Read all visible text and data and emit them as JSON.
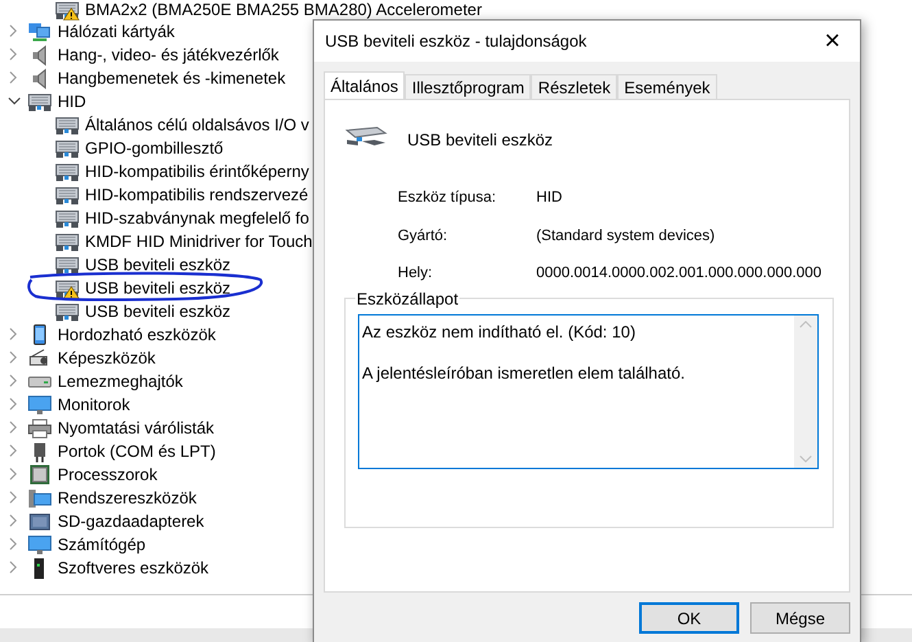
{
  "device_tree": {
    "continued_children": [
      {
        "label": "BMA2x2 (BMA250E BMA255 BMA280) Accelerometer",
        "warning": true
      }
    ],
    "categories": [
      {
        "label": "Hálózati kártyák",
        "expanded": false
      },
      {
        "label": "Hang-, video- és játékvezérlők",
        "expanded": false
      },
      {
        "label": "Hangbemenetek és -kimenetek",
        "expanded": false
      },
      {
        "label": "HID",
        "expanded": true,
        "children": [
          {
            "label": "Általános célú oldalsávos I/O v",
            "warning": false
          },
          {
            "label": "GPIO-gombillesztő",
            "warning": false
          },
          {
            "label": "HID-kompatibilis érintőképerny",
            "warning": false
          },
          {
            "label": "HID-kompatibilis rendszervezé",
            "warning": false
          },
          {
            "label": "HID-szabványnak megfelelő fo",
            "warning": false
          },
          {
            "label": "KMDF HID Minidriver for Touch",
            "warning": false
          },
          {
            "label": "USB beviteli eszköz",
            "warning": false
          },
          {
            "label": "USB beviteli eszköz",
            "warning": true
          },
          {
            "label": "USB beviteli eszköz",
            "warning": false
          }
        ]
      },
      {
        "label": "Hordozható eszközök",
        "expanded": false
      },
      {
        "label": "Képeszközök",
        "expanded": false
      },
      {
        "label": "Lemezmeghajtók",
        "expanded": false
      },
      {
        "label": "Monitorok",
        "expanded": false
      },
      {
        "label": "Nyomtatási várólisták",
        "expanded": false
      },
      {
        "label": "Portok (COM és LPT)",
        "expanded": false
      },
      {
        "label": "Processzorok",
        "expanded": false
      },
      {
        "label": "Rendszereszközök",
        "expanded": false
      },
      {
        "label": "SD-gazdaadapterek",
        "expanded": false
      },
      {
        "label": "Számítógép",
        "expanded": false
      },
      {
        "label": "Szoftveres eszközök",
        "expanded": false
      }
    ]
  },
  "dialog": {
    "title": "USB beviteli eszköz - tulajdonságok",
    "close": "×",
    "tabs": [
      {
        "label": "Általános",
        "selected": true
      },
      {
        "label": "Illesztőprogram",
        "selected": false
      },
      {
        "label": "Részletek",
        "selected": false
      },
      {
        "label": "Események",
        "selected": false
      }
    ],
    "device_name": "USB beviteli eszköz",
    "properties": [
      {
        "label": "Eszköz típusa:",
        "value": "HID"
      },
      {
        "label": "Gyártó:",
        "value": "(Standard system devices)"
      },
      {
        "label": "Hely:",
        "value": "0000.0014.0000.002.001.000.000.000.000"
      }
    ],
    "status_group": {
      "title": "Eszközállapot",
      "lines": [
        "Az eszköz nem indítható el. (Kód: 10)",
        "A jelentésleíróban ismeretlen elem található."
      ]
    },
    "buttons": [
      {
        "label": "OK",
        "default": true
      },
      {
        "label": "Mégse",
        "default": false
      }
    ]
  }
}
